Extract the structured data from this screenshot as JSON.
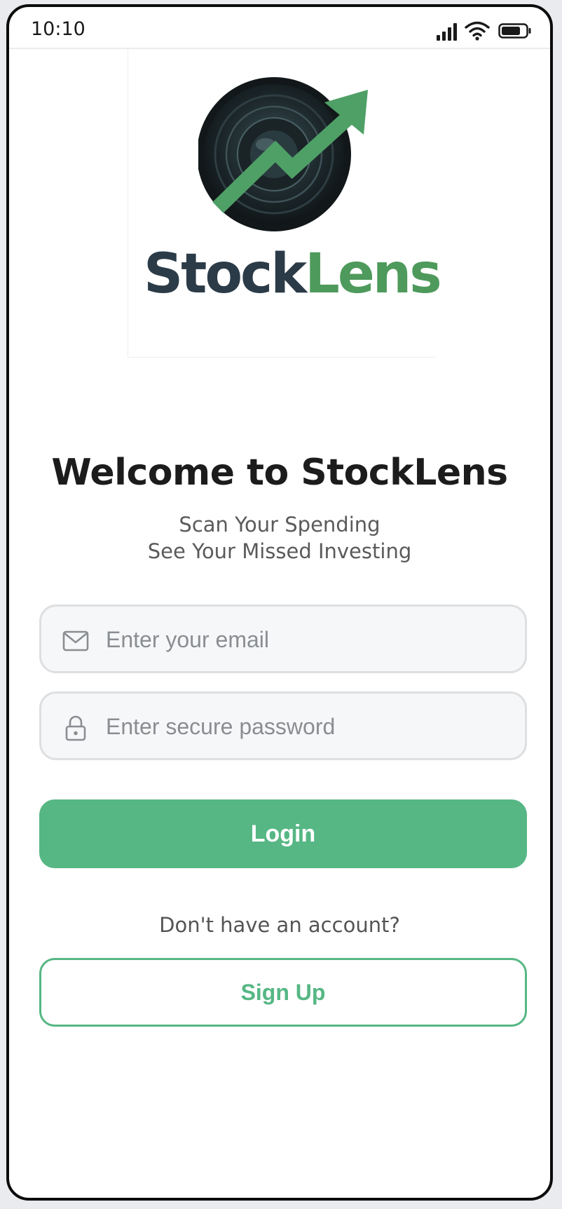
{
  "status_bar": {
    "time": "10:10",
    "icons": [
      "signal-icon",
      "wifi-icon",
      "battery-icon"
    ]
  },
  "logo": {
    "word_part1": "Stock",
    "word_part2": "Lens",
    "icon": "camera-lens-with-rising-arrow"
  },
  "welcome": {
    "title": "Welcome to StockLens",
    "subtitle_line1": "Scan Your Spending",
    "subtitle_line2": "See Your Missed Investing"
  },
  "form": {
    "email_placeholder": "Enter your email",
    "email_value": "",
    "email_icon": "mail-icon",
    "password_placeholder": "Enter secure password",
    "password_value": "",
    "password_icon": "lock-icon",
    "login_label": "Login",
    "account_prompt": "Don't have an account?",
    "signup_label": "Sign Up"
  },
  "colors": {
    "accent": "#56b784",
    "logo_dark": "#2b3b47",
    "logo_green": "#4e9a5c"
  }
}
